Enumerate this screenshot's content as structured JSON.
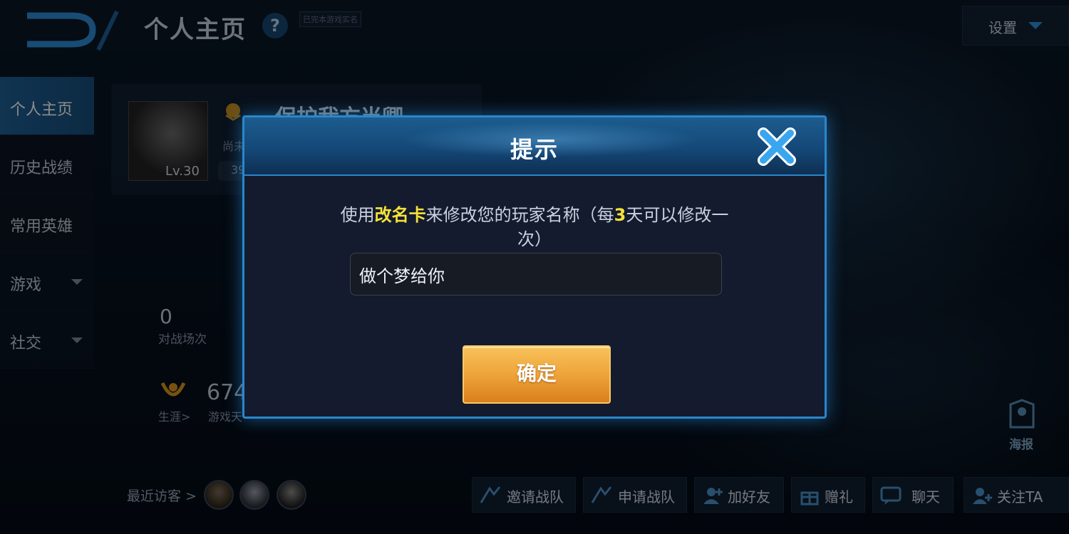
{
  "header": {
    "title": "个人主页",
    "help_label": "?",
    "realname_tag": "已完本游戏实名",
    "settings_label": "设置"
  },
  "sidebar": {
    "items": [
      {
        "label": "个人主页",
        "active": true
      },
      {
        "label": "历史战绩"
      },
      {
        "label": "常用英雄"
      },
      {
        "label": "游戏",
        "has_dropdown": true
      },
      {
        "label": "社交",
        "has_dropdown": true
      }
    ]
  },
  "profile": {
    "level": "Lv.30",
    "name": "保护我方当卿",
    "sub": "尚未",
    "badge": "39"
  },
  "stats": {
    "battles_value": "0",
    "battles_label": "对战场次",
    "career_label": "生涯>",
    "games_value": "674",
    "games_label": "游戏天"
  },
  "visitors": {
    "label": "最近访客 >"
  },
  "actions": [
    {
      "label": "邀请战队",
      "icon": "team-invite-icon"
    },
    {
      "label": "申请战队",
      "icon": "team-apply-icon"
    },
    {
      "label": "加好友",
      "icon": "add-friend-icon"
    },
    {
      "label": "赠礼",
      "icon": "gift-icon"
    },
    {
      "label": "聊天",
      "icon": "chat-icon"
    },
    {
      "label": "关注TA",
      "icon": "follow-icon"
    }
  ],
  "poster": {
    "label": "海报"
  },
  "dialog": {
    "title": "提示",
    "msg_prefix": "使用",
    "msg_card": "改名卡",
    "msg_mid": "来修改您的玩家名称（每",
    "msg_days": "3",
    "msg_suffix": "天可以修改一次）",
    "input_value": "做个梦给你",
    "confirm_label": "确定"
  },
  "colors": {
    "accent_blue": "#2a86cc",
    "highlight_yellow": "#f5e23a",
    "confirm_orange": "#eea43a"
  }
}
